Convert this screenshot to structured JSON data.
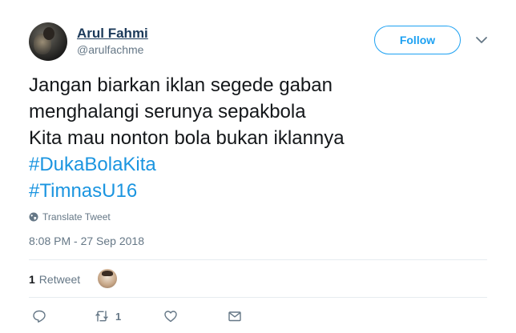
{
  "author": {
    "display_name": "Arul Fahmi",
    "handle": "@arulfachme"
  },
  "follow_label": "Follow",
  "tweet": {
    "lines": [
      "Jangan biarkan iklan segede gaban",
      "menghalangi serunya sepakbola",
      "Kita mau nonton bola bukan iklannya"
    ],
    "hashtags": [
      "#DukaBolaKita",
      "#TimnasU16"
    ]
  },
  "translate_label": "Translate Tweet",
  "timestamp": "8:08 PM - 27 Sep 2018",
  "stats": {
    "retweet_count": "1",
    "retweet_label": "Retweet"
  },
  "actions": {
    "retweet_count": "1"
  },
  "icons": {
    "menu": "chevron-down-icon",
    "translate": "globe-icon",
    "reply": "reply-icon",
    "retweet": "retweet-icon",
    "like": "heart-icon",
    "message": "envelope-icon"
  },
  "colors": {
    "accent": "#1da1f2",
    "hashtag": "#1b95e0",
    "muted": "#657786",
    "text": "#14171a"
  }
}
